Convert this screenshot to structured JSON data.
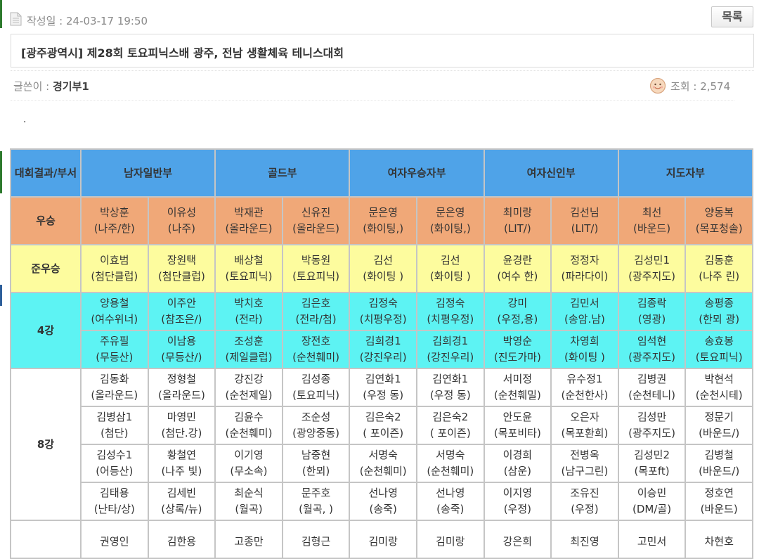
{
  "post": {
    "date_label": "작성일 : 24-03-17 19:50",
    "list_button": "목록",
    "title": "[광주광역시] 제28회 토요피닉스배 광주, 전남 생활체육 테니스대회",
    "author_label": "글쓴이 : ",
    "author_name": "경기부1",
    "views_label": "조회 : 2,574",
    "content_text": "."
  },
  "table": {
    "corner": "대회결과/부서",
    "divisions": [
      "남자일반부",
      "골드부",
      "여자우승자부",
      "여자신인부",
      "지도자부"
    ],
    "winner_label": "우승",
    "winner": [
      [
        "박상훈",
        "(나주/한)"
      ],
      [
        "이유성",
        "(나주)"
      ],
      [
        "박재관",
        "(올라운드)"
      ],
      [
        "신유진",
        "(올라운드)"
      ],
      [
        "문은영",
        "(화이팅,)"
      ],
      [
        "문은영",
        "(화이팅,)"
      ],
      [
        "최미랑",
        "(LIT/)"
      ],
      [
        "김선님",
        "(LIT/)"
      ],
      [
        "최선",
        "(바운드)"
      ],
      [
        "양동복",
        "(목포청솔)"
      ]
    ],
    "runnerup_label": "준우승",
    "runnerup": [
      [
        "이효범",
        "(첨단클럽)"
      ],
      [
        "장원택",
        "(첨단클럽)"
      ],
      [
        "배상철",
        "(토요피닉)"
      ],
      [
        "박동원",
        "(토요피닉)"
      ],
      [
        "김선",
        "(화이팅 )"
      ],
      [
        "김선",
        "(화이팅 )"
      ],
      [
        "윤경란",
        "(여수 한)"
      ],
      [
        "정정자",
        "(파라다이)"
      ],
      [
        "김성민1",
        "(광주지도)"
      ],
      [
        "김동훈",
        "(나주 린)"
      ]
    ],
    "semi_label": "4강",
    "semi": [
      [
        [
          "양용철",
          "(여수위너)"
        ],
        [
          "이주안",
          "(참조은/)"
        ],
        [
          "박치호",
          "(전라)"
        ],
        [
          "김은호",
          "(전라/첨)"
        ],
        [
          "김정숙",
          "(치평우정)"
        ],
        [
          "김정숙",
          "(치평우정)"
        ],
        [
          "강미",
          "(우정,용)"
        ],
        [
          "김민서",
          "(송암.남)"
        ],
        [
          "김종락",
          "(영광)"
        ],
        [
          "송평종",
          "(한뫼 광)"
        ]
      ],
      [
        [
          "주유필",
          "(무등산)"
        ],
        [
          "이남용",
          "(무등산/)"
        ],
        [
          "조성훈",
          "(제일클럽)"
        ],
        [
          "장전호",
          "(순천훼미)"
        ],
        [
          "김희경1",
          "(강진우리)"
        ],
        [
          "김희경1",
          "(강진우리)"
        ],
        [
          "박영순",
          "(진도가마)"
        ],
        [
          "차영희",
          "(화이팅 )"
        ],
        [
          "임석현",
          "(광주지도)"
        ],
        [
          "송효봉",
          "(토요피닉)"
        ]
      ]
    ],
    "quarter_label": "8강",
    "quarter": [
      [
        [
          "김동화",
          "(올라운드)"
        ],
        [
          "정형철",
          "(올라운드)"
        ],
        [
          "강진강",
          "(순천제일)"
        ],
        [
          "김성종",
          "(토요피닉)"
        ],
        [
          "김연화1",
          "(우정 동)"
        ],
        [
          "김연화1",
          "(우정 동)"
        ],
        [
          "서미정",
          "(순천훼밀)"
        ],
        [
          "유수정1",
          "(순천한사)"
        ],
        [
          "김병권",
          "(순천테니)"
        ],
        [
          "박현석",
          "(순천시테)"
        ]
      ],
      [
        [
          "김병삼1",
          "(첨단)"
        ],
        [
          "마영민",
          "(첨단.강)"
        ],
        [
          "김윤수",
          "(순천훼미)"
        ],
        [
          "조순성",
          "(광양중동)"
        ],
        [
          "김은숙2",
          "( 포이즌)"
        ],
        [
          "김은숙2",
          "( 포이즌)"
        ],
        [
          "안도윤",
          "(목포비타)"
        ],
        [
          "오은자",
          "(목포환희)"
        ],
        [
          "김성만",
          "(광주지도)"
        ],
        [
          "정문기",
          "(바운드/)"
        ]
      ],
      [
        [
          "김성수1",
          "(어등산)"
        ],
        [
          "황철연",
          "(나주 빛)"
        ],
        [
          "이기영",
          "(무소속)"
        ],
        [
          "남중현",
          "(한뫼)"
        ],
        [
          "서명숙",
          "(순천훼미)"
        ],
        [
          "서명숙",
          "(순천훼미)"
        ],
        [
          "이경희",
          "(삼운)"
        ],
        [
          "전병옥",
          "(남구그린)"
        ],
        [
          "김성민2",
          "(목포ft)"
        ],
        [
          "김병철",
          "(바운드/)"
        ]
      ],
      [
        [
          "김태용",
          "(난타/상)"
        ],
        [
          "김세빈",
          "(상록/뉴)"
        ],
        [
          "최순식",
          "(월곡)"
        ],
        [
          "문주호",
          "(월곡, )"
        ],
        [
          "선나영",
          "(송죽)"
        ],
        [
          "선나영",
          "(송죽)"
        ],
        [
          "이지영",
          "(우정)"
        ],
        [
          "조유진",
          "(우정)"
        ],
        [
          "이승민",
          "(DM/골)"
        ],
        [
          "정호연",
          "(바운드)"
        ]
      ]
    ],
    "partial_row": [
      "권영인",
      "김한용",
      "고종만",
      "김형근",
      "김미랑",
      "김미랑",
      "강은희",
      "최진영",
      "고민서",
      "차현호"
    ]
  },
  "colors": {
    "header": "#4fa3e8",
    "winner": "#f0a878",
    "runnerup": "#fdfc9e",
    "semi": "#5df3f3",
    "border": "#c5c5c5"
  },
  "icons": [
    "document-icon",
    "smiley-face-icon"
  ]
}
